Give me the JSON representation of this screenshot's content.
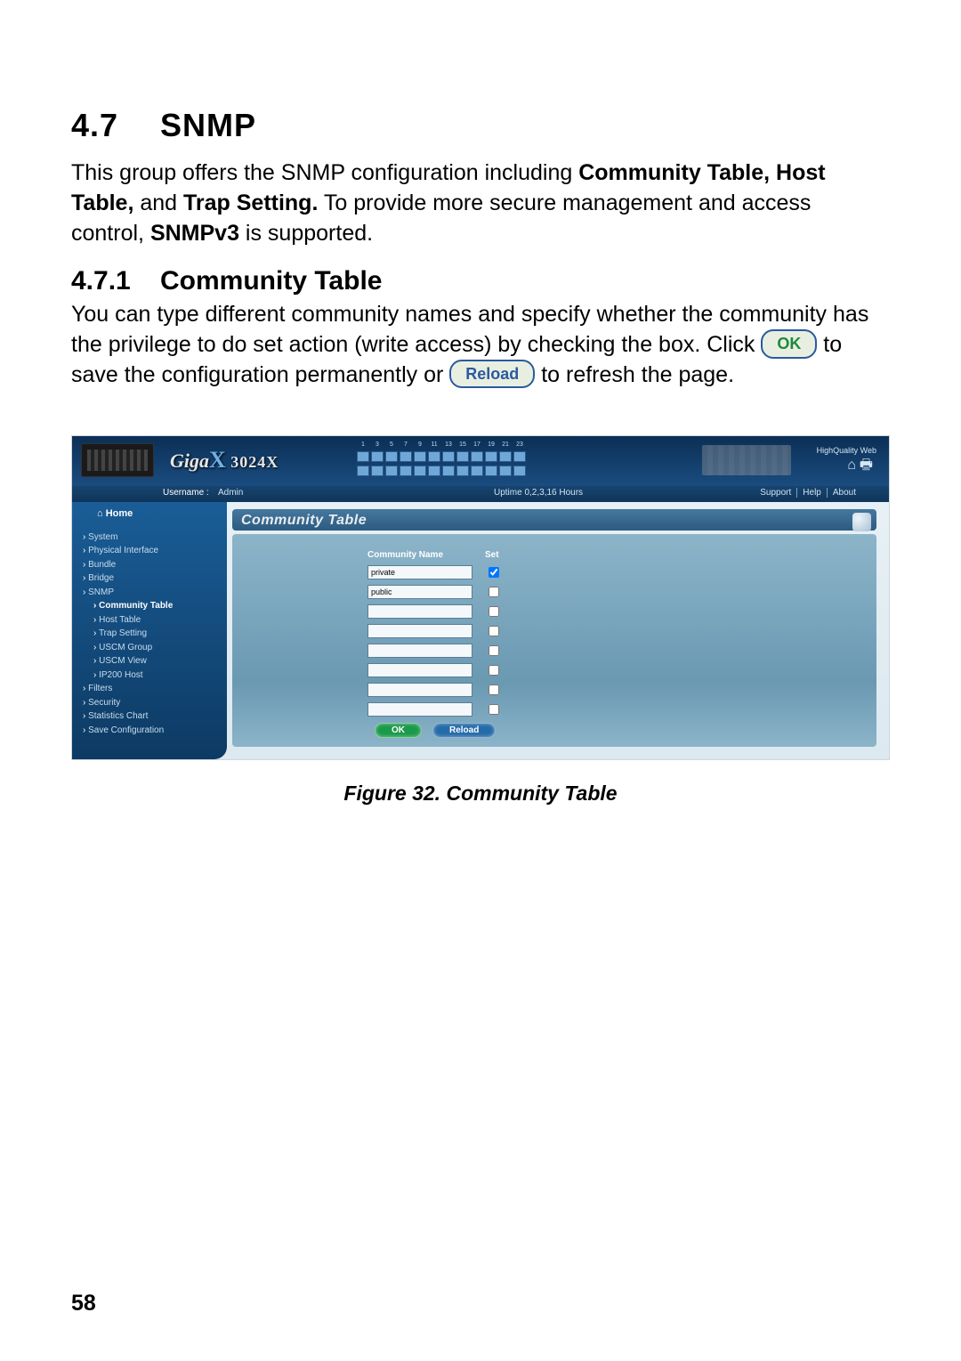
{
  "heading": {
    "number": "4.7",
    "title": "SNMP"
  },
  "intro": {
    "line1a": "This group offers the SNMP configuration including ",
    "bold1": "Community Table, Host Table,",
    "line1b": " and ",
    "bold2": "Trap Setting.",
    "line1c": " To provide more secure management and access control, ",
    "bold3": "SNMPv3",
    "line1d": " is supported."
  },
  "sub": {
    "number": "4.7.1",
    "title": "Community Table"
  },
  "para2a": "You can type different community names and specify whether the community has the privilege to do set action (write access) by checking the box. Click ",
  "btn_ok_text": "OK",
  "para2b": " to save the configuration permanently or ",
  "btn_reload_text": "Reload",
  "para2c": " to refresh the page.",
  "figure": {
    "logo_giga": "Giga",
    "logo_x": "X",
    "logo_model": "3024X",
    "corner_label": "HighQuality Web",
    "username_label": "Username :",
    "username_value": "Admin",
    "status_text": "Uptime 0,2,3,16 Hours",
    "nav_links": [
      "Support",
      "Help",
      "About"
    ],
    "home": "Home",
    "sidebar": [
      {
        "label": "System",
        "sub": false
      },
      {
        "label": "Physical Interface",
        "sub": false
      },
      {
        "label": "Bundle",
        "sub": false
      },
      {
        "label": "Bridge",
        "sub": false
      },
      {
        "label": "SNMP",
        "sub": false
      },
      {
        "label": "Community Table",
        "sub": true,
        "active": true
      },
      {
        "label": "Host Table",
        "sub": true
      },
      {
        "label": "Trap Setting",
        "sub": true
      },
      {
        "label": "USCM Group",
        "sub": true
      },
      {
        "label": "USCM View",
        "sub": true
      },
      {
        "label": "IP200 Host",
        "sub": true
      },
      {
        "label": "Filters",
        "sub": false
      },
      {
        "label": "Security",
        "sub": false
      },
      {
        "label": "Statistics Chart",
        "sub": false
      },
      {
        "label": "Save Configuration",
        "sub": false
      }
    ],
    "content_title": "Community Table",
    "th_name": "Community Name",
    "th_set": "Set",
    "rows": [
      {
        "name": "private",
        "set": true
      },
      {
        "name": "public",
        "set": false
      },
      {
        "name": "",
        "set": false
      },
      {
        "name": "",
        "set": false
      },
      {
        "name": "",
        "set": false
      },
      {
        "name": "",
        "set": false
      },
      {
        "name": "",
        "set": false
      },
      {
        "name": "",
        "set": false
      }
    ],
    "btn_ok": "OK",
    "btn_reload": "Reload",
    "port_count": 24
  },
  "caption": "Figure 32.  Community Table",
  "page_number": "58"
}
